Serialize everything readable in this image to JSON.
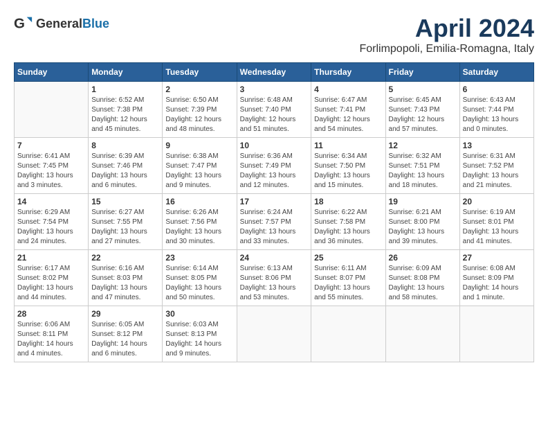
{
  "header": {
    "logo_general": "General",
    "logo_blue": "Blue",
    "title": "April 2024",
    "subtitle": "Forlimpopoli, Emilia-Romagna, Italy"
  },
  "days_of_week": [
    "Sunday",
    "Monday",
    "Tuesday",
    "Wednesday",
    "Thursday",
    "Friday",
    "Saturday"
  ],
  "weeks": [
    [
      {
        "day": "",
        "detail": ""
      },
      {
        "day": "1",
        "detail": "Sunrise: 6:52 AM\nSunset: 7:38 PM\nDaylight: 12 hours\nand 45 minutes."
      },
      {
        "day": "2",
        "detail": "Sunrise: 6:50 AM\nSunset: 7:39 PM\nDaylight: 12 hours\nand 48 minutes."
      },
      {
        "day": "3",
        "detail": "Sunrise: 6:48 AM\nSunset: 7:40 PM\nDaylight: 12 hours\nand 51 minutes."
      },
      {
        "day": "4",
        "detail": "Sunrise: 6:47 AM\nSunset: 7:41 PM\nDaylight: 12 hours\nand 54 minutes."
      },
      {
        "day": "5",
        "detail": "Sunrise: 6:45 AM\nSunset: 7:43 PM\nDaylight: 12 hours\nand 57 minutes."
      },
      {
        "day": "6",
        "detail": "Sunrise: 6:43 AM\nSunset: 7:44 PM\nDaylight: 13 hours\nand 0 minutes."
      }
    ],
    [
      {
        "day": "7",
        "detail": "Sunrise: 6:41 AM\nSunset: 7:45 PM\nDaylight: 13 hours\nand 3 minutes."
      },
      {
        "day": "8",
        "detail": "Sunrise: 6:39 AM\nSunset: 7:46 PM\nDaylight: 13 hours\nand 6 minutes."
      },
      {
        "day": "9",
        "detail": "Sunrise: 6:38 AM\nSunset: 7:47 PM\nDaylight: 13 hours\nand 9 minutes."
      },
      {
        "day": "10",
        "detail": "Sunrise: 6:36 AM\nSunset: 7:49 PM\nDaylight: 13 hours\nand 12 minutes."
      },
      {
        "day": "11",
        "detail": "Sunrise: 6:34 AM\nSunset: 7:50 PM\nDaylight: 13 hours\nand 15 minutes."
      },
      {
        "day": "12",
        "detail": "Sunrise: 6:32 AM\nSunset: 7:51 PM\nDaylight: 13 hours\nand 18 minutes."
      },
      {
        "day": "13",
        "detail": "Sunrise: 6:31 AM\nSunset: 7:52 PM\nDaylight: 13 hours\nand 21 minutes."
      }
    ],
    [
      {
        "day": "14",
        "detail": "Sunrise: 6:29 AM\nSunset: 7:54 PM\nDaylight: 13 hours\nand 24 minutes."
      },
      {
        "day": "15",
        "detail": "Sunrise: 6:27 AM\nSunset: 7:55 PM\nDaylight: 13 hours\nand 27 minutes."
      },
      {
        "day": "16",
        "detail": "Sunrise: 6:26 AM\nSunset: 7:56 PM\nDaylight: 13 hours\nand 30 minutes."
      },
      {
        "day": "17",
        "detail": "Sunrise: 6:24 AM\nSunset: 7:57 PM\nDaylight: 13 hours\nand 33 minutes."
      },
      {
        "day": "18",
        "detail": "Sunrise: 6:22 AM\nSunset: 7:58 PM\nDaylight: 13 hours\nand 36 minutes."
      },
      {
        "day": "19",
        "detail": "Sunrise: 6:21 AM\nSunset: 8:00 PM\nDaylight: 13 hours\nand 39 minutes."
      },
      {
        "day": "20",
        "detail": "Sunrise: 6:19 AM\nSunset: 8:01 PM\nDaylight: 13 hours\nand 41 minutes."
      }
    ],
    [
      {
        "day": "21",
        "detail": "Sunrise: 6:17 AM\nSunset: 8:02 PM\nDaylight: 13 hours\nand 44 minutes."
      },
      {
        "day": "22",
        "detail": "Sunrise: 6:16 AM\nSunset: 8:03 PM\nDaylight: 13 hours\nand 47 minutes."
      },
      {
        "day": "23",
        "detail": "Sunrise: 6:14 AM\nSunset: 8:05 PM\nDaylight: 13 hours\nand 50 minutes."
      },
      {
        "day": "24",
        "detail": "Sunrise: 6:13 AM\nSunset: 8:06 PM\nDaylight: 13 hours\nand 53 minutes."
      },
      {
        "day": "25",
        "detail": "Sunrise: 6:11 AM\nSunset: 8:07 PM\nDaylight: 13 hours\nand 55 minutes."
      },
      {
        "day": "26",
        "detail": "Sunrise: 6:09 AM\nSunset: 8:08 PM\nDaylight: 13 hours\nand 58 minutes."
      },
      {
        "day": "27",
        "detail": "Sunrise: 6:08 AM\nSunset: 8:09 PM\nDaylight: 14 hours\nand 1 minute."
      }
    ],
    [
      {
        "day": "28",
        "detail": "Sunrise: 6:06 AM\nSunset: 8:11 PM\nDaylight: 14 hours\nand 4 minutes."
      },
      {
        "day": "29",
        "detail": "Sunrise: 6:05 AM\nSunset: 8:12 PM\nDaylight: 14 hours\nand 6 minutes."
      },
      {
        "day": "30",
        "detail": "Sunrise: 6:03 AM\nSunset: 8:13 PM\nDaylight: 14 hours\nand 9 minutes."
      },
      {
        "day": "",
        "detail": ""
      },
      {
        "day": "",
        "detail": ""
      },
      {
        "day": "",
        "detail": ""
      },
      {
        "day": "",
        "detail": ""
      }
    ]
  ]
}
